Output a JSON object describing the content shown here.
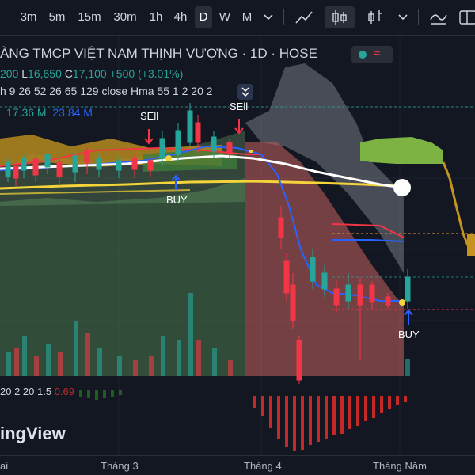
{
  "toolbar": {
    "timeframes": [
      "3m",
      "5m",
      "15m",
      "30m",
      "1h",
      "4h",
      "D",
      "W",
      "M"
    ],
    "active_timeframe": "D",
    "icons": [
      "timeframe-dropdown-icon",
      "line-chart-icon",
      "candles-icon",
      "bars-icon",
      "chart-type-dropdown-icon"
    ]
  },
  "legend": {
    "title": "ÀNG TMCP VIỆT NAM THỊNH VƯỢNG · 1D · HOSE",
    "ohlc_prefix": "200",
    "low_label": "L",
    "low_value": "16,650",
    "close_label": "C",
    "close_value": "17,100",
    "change": "+500 (+3.01%)",
    "indicator": "h 9 26 52 26 65 129 close Hma 55 1 2 20 2",
    "volume_a": "17.36 M",
    "volume_b": "23.84 M"
  },
  "signals": {
    "sell1": "SEll",
    "sell2": "SEll",
    "buy1": "BUY",
    "buy2": "BUY"
  },
  "oscillator": {
    "label_white": "20 2 20 1.5",
    "label_red": "0.69"
  },
  "brand": "ingView",
  "xaxis": {
    "ticks": [
      "ai",
      "Tháng 3",
      "Tháng 4",
      "Tháng Năm"
    ]
  },
  "colors": {
    "up": "#26a69a",
    "down": "#f23645",
    "accent": "#2962ff",
    "cloud": "#8bc34a",
    "cloud_orange": "#c69320",
    "yellow": "#f5d33a"
  }
}
